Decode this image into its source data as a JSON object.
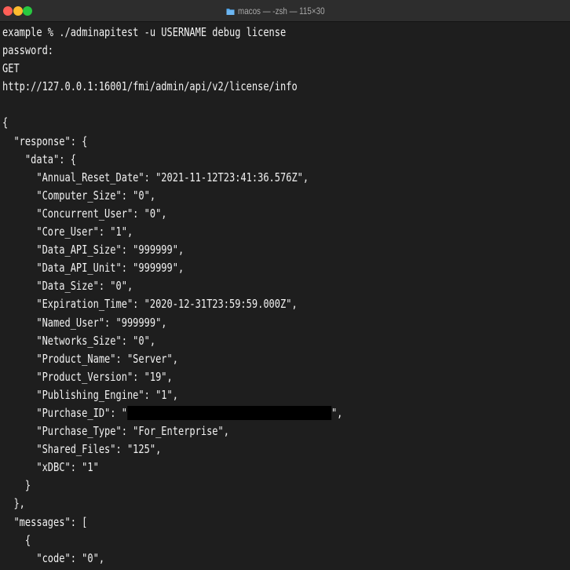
{
  "window": {
    "title": "macos — -zsh — 115×30",
    "title_icon": "folder-icon",
    "colors": {
      "background": "#1e1e1e",
      "titlebar": "#2d2d2d",
      "text": "#f2f2f2",
      "close": "#ff5f57",
      "minimize": "#febc2e",
      "zoom": "#28c840",
      "folder": "#4fa3e8"
    }
  },
  "terminal": {
    "lines": [
      "example % ./adminapitest -u USERNAME debug license",
      "password:",
      "GET",
      "http://127.0.0.1:16001/fmi/admin/api/v2/license/info",
      "",
      "{",
      "  \"response\": {",
      "    \"data\": {",
      "      \"Annual_Reset_Date\": \"2021-11-12T23:41:36.576Z\",",
      "      \"Computer_Size\": \"0\",",
      "      \"Concurrent_User\": \"0\",",
      "      \"Core_User\": \"1\",",
      "      \"Data_API_Size\": \"999999\",",
      "      \"Data_API_Unit\": \"999999\",",
      "      \"Data_Size\": \"0\",",
      "      \"Expiration_Time\": \"2020-12-31T23:59:59.000Z\",",
      "      \"Named_User\": \"999999\",",
      "      \"Networks_Size\": \"0\",",
      "      \"Product_Name\": \"Server\",",
      "      \"Product_Version\": \"19\",",
      "      \"Publishing_Engine\": \"1\",",
      "      \"Purchase_ID\": \"",
      "      \"Purchase_Type\": \"For_Enterprise\",",
      "      \"Shared_Files\": \"125\",",
      "      \"xDBC\": \"1\"",
      "    }",
      "  },",
      "  \"messages\": [",
      "    {",
      "      \"code\": \"0\","
    ],
    "purchase_id_suffix": "\","
  }
}
